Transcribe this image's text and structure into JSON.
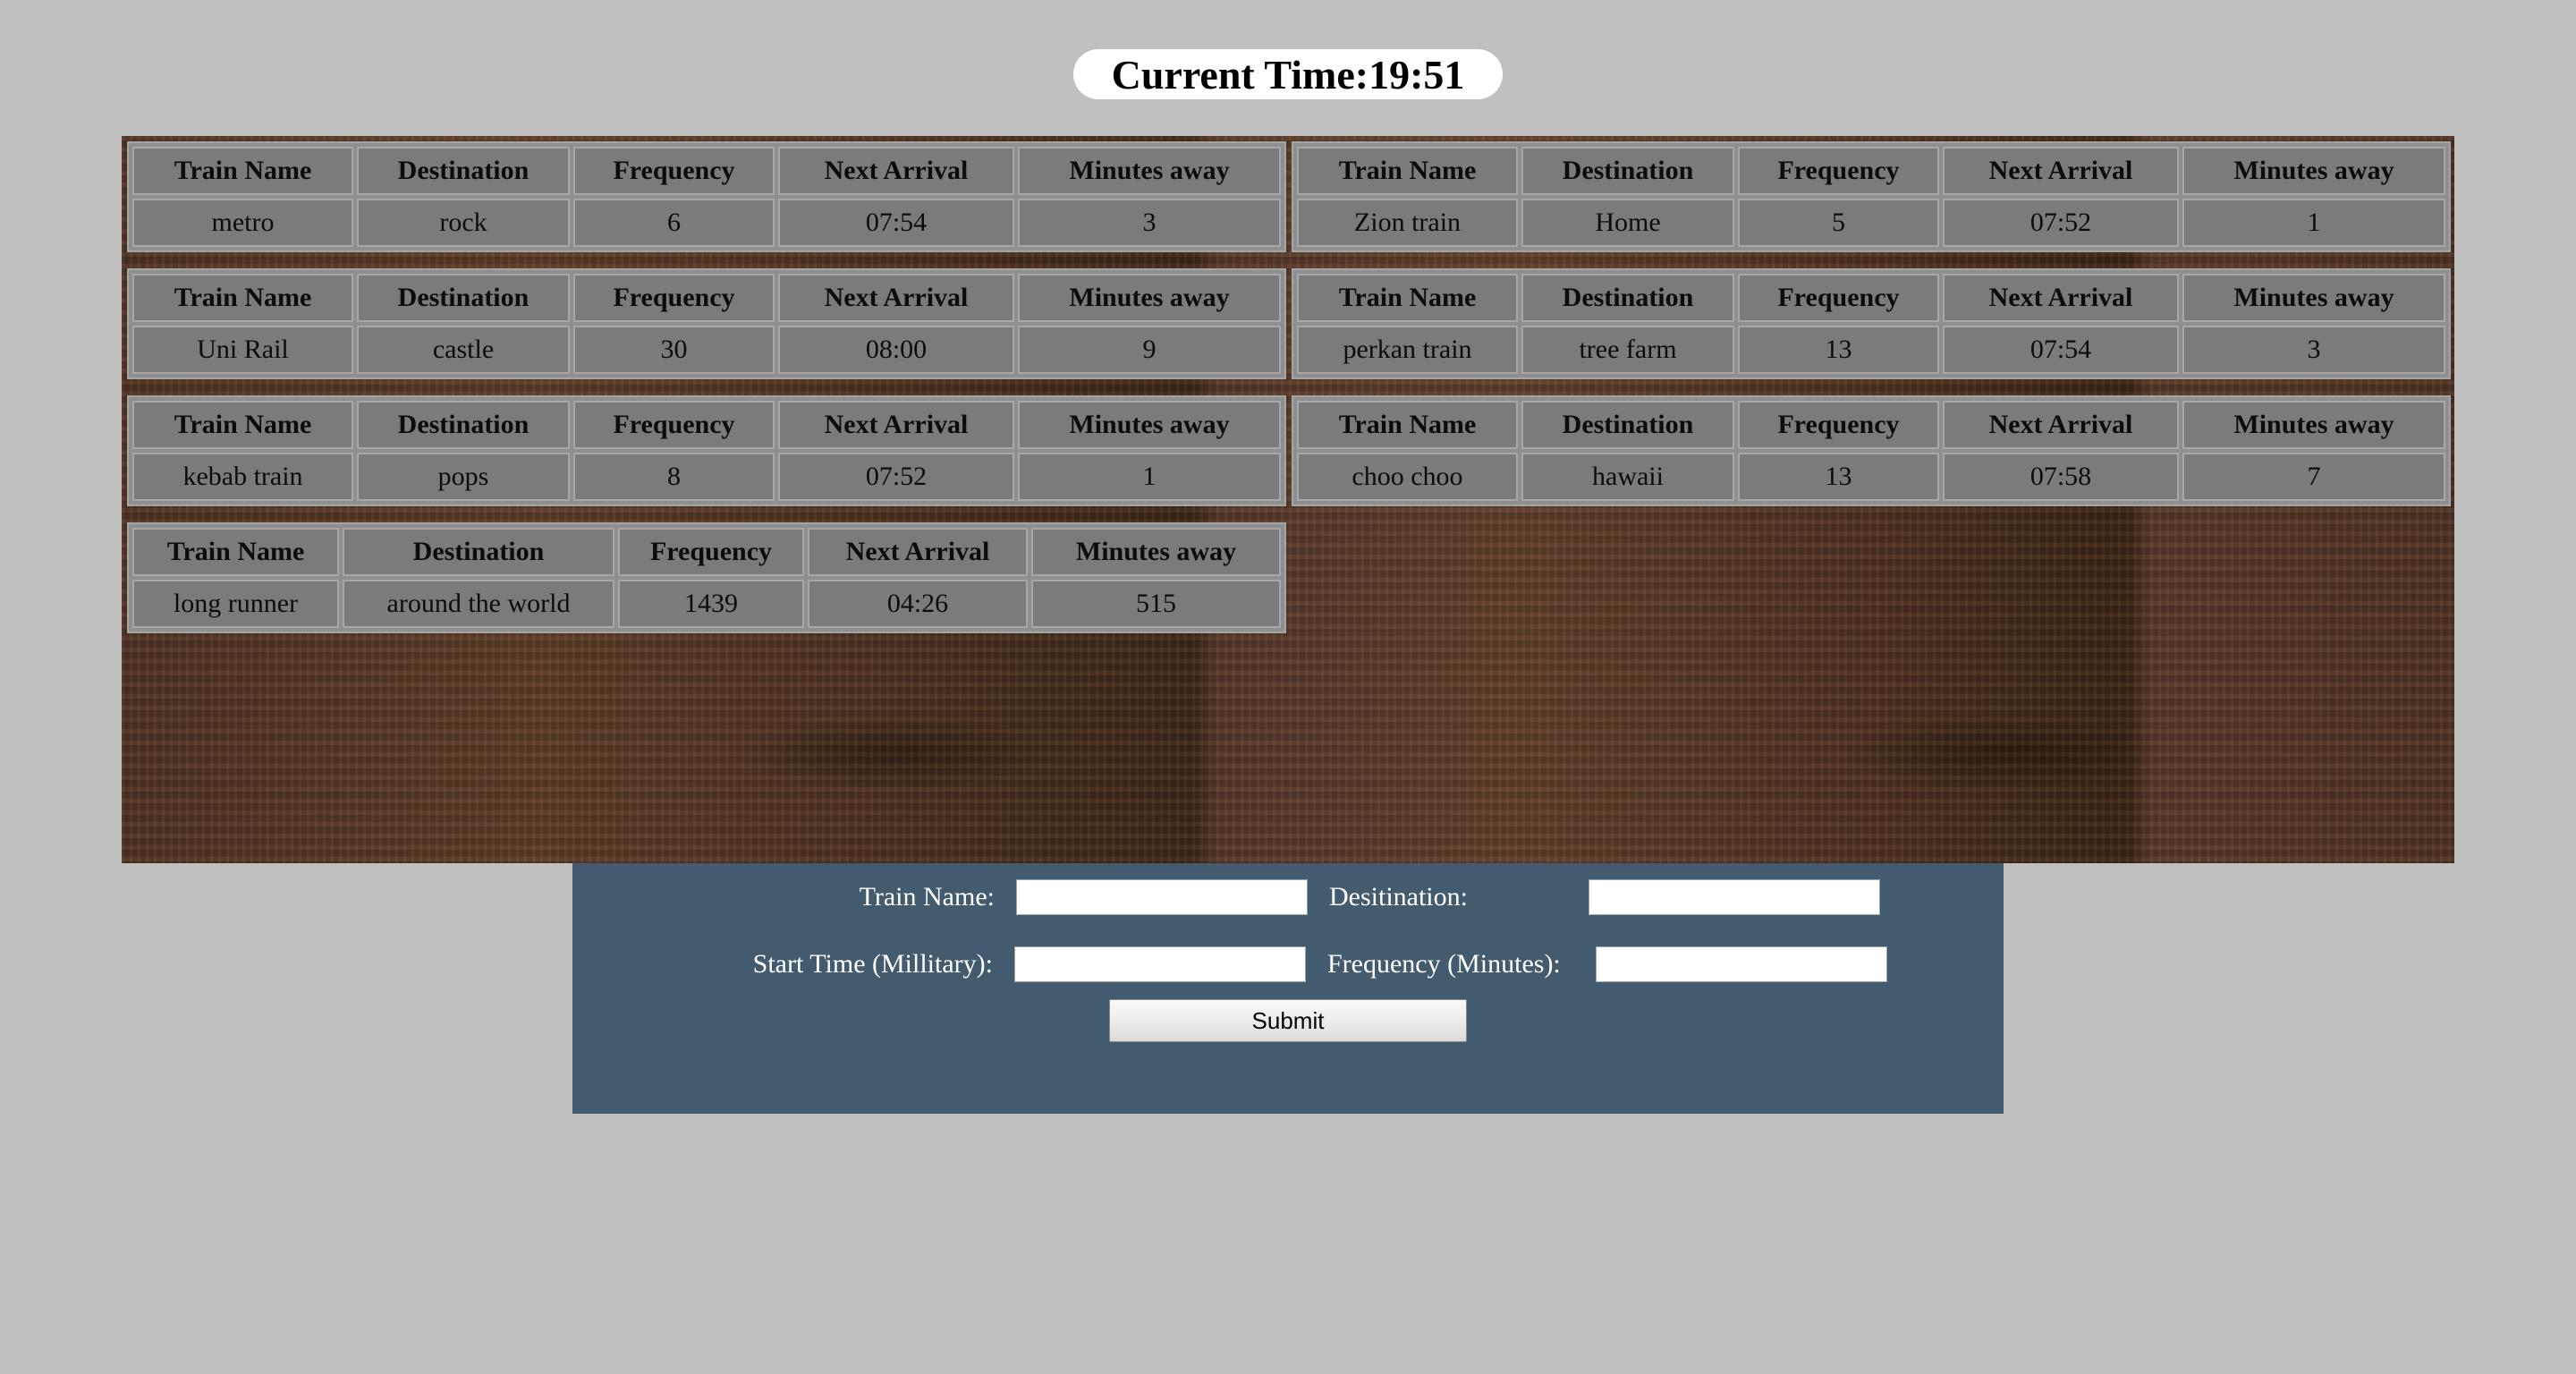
{
  "clock": {
    "label": "Current Time:",
    "value": "19:51"
  },
  "columns": [
    "Train Name",
    "Destination",
    "Frequency",
    "Next Arrival",
    "Minutes away"
  ],
  "trains": [
    {
      "name": "metro",
      "destination": "rock",
      "frequency": "6",
      "next_arrival": "07:54",
      "minutes_away": "3"
    },
    {
      "name": "Zion train",
      "destination": "Home",
      "frequency": "5",
      "next_arrival": "07:52",
      "minutes_away": "1"
    },
    {
      "name": "Uni Rail",
      "destination": "castle",
      "frequency": "30",
      "next_arrival": "08:00",
      "minutes_away": "9"
    },
    {
      "name": "perkan train",
      "destination": "tree farm",
      "frequency": "13",
      "next_arrival": "07:54",
      "minutes_away": "3"
    },
    {
      "name": "kebab train",
      "destination": "pops",
      "frequency": "8",
      "next_arrival": "07:52",
      "minutes_away": "1"
    },
    {
      "name": "choo choo",
      "destination": "hawaii",
      "frequency": "13",
      "next_arrival": "07:58",
      "minutes_away": "7"
    },
    {
      "name": "long runner",
      "destination": "around the world",
      "frequency": "1439",
      "next_arrival": "04:26",
      "minutes_away": "515"
    }
  ],
  "form": {
    "train_name_label": "Train Name:",
    "destination_label": "Desitination:",
    "start_time_label": "Start Time (Millitary):",
    "frequency_label": "Frequency (Minutes):",
    "train_name_value": "",
    "destination_value": "",
    "start_time_value": "",
    "frequency_value": "",
    "submit_label": "Submit"
  }
}
